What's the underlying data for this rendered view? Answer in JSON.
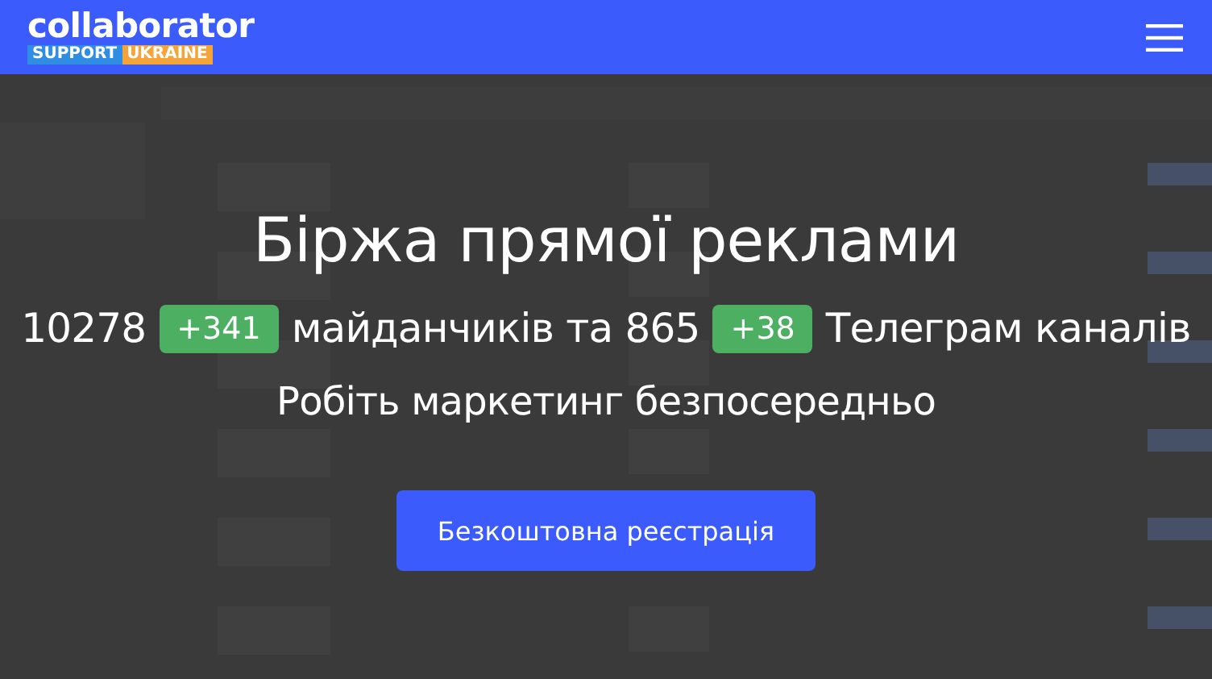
{
  "header": {
    "logo": "collaborator",
    "logo_tags": [
      {
        "label": "SUPPORT",
        "color": "#2f8de4"
      },
      {
        "label": "UKRAINE",
        "color": "#f5a43a"
      }
    ]
  },
  "hero": {
    "title": "Біржа прямої реклами",
    "stats": [
      {
        "kind": "text",
        "text": "10278"
      },
      {
        "kind": "badge",
        "text": "+341"
      },
      {
        "kind": "text",
        "text": "майданчиків та 865"
      },
      {
        "kind": "badge",
        "text": "+38"
      },
      {
        "kind": "text",
        "text": "Телеграм каналів"
      }
    ],
    "subtitle": "Робіть маркетинг безпосередньо",
    "button": "Безкоштовна реєстрація"
  }
}
